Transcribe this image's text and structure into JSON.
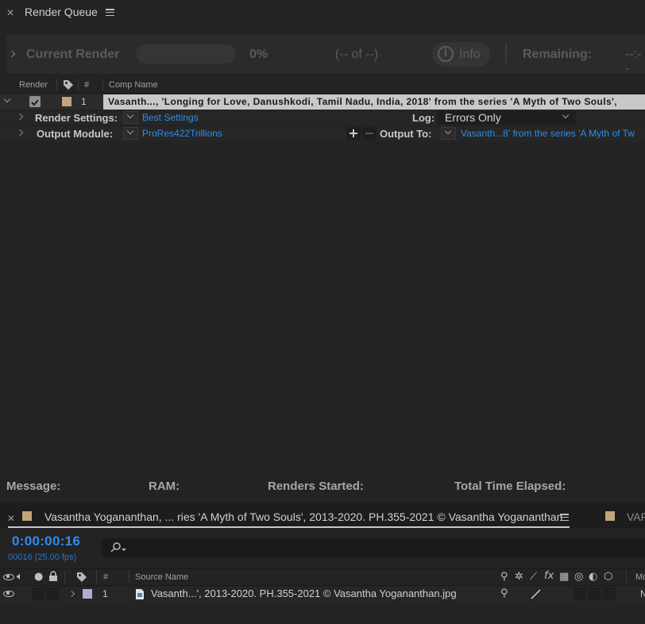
{
  "render_queue": {
    "panel_title": "Render Queue",
    "current_render_label": "Current Render",
    "progress_percent": "0%",
    "frame_counter": "(-- of --)",
    "info_label": "Info",
    "remaining_label": "Remaining:",
    "remaining_value": "--:--"
  },
  "columns": {
    "render": "Render",
    "number": "#",
    "comp_name": "Comp Name"
  },
  "queue_item": {
    "index": "1",
    "comp_name": "Vasanth..., 'Longing for Love, Danushkodi, Tamil Nadu, India, 2018' from the series 'A Myth of Two Souls',",
    "label_color": "#c4a57a",
    "render_settings_label": "Render Settings:",
    "render_settings_value": "Best Settings",
    "log_label": "Log:",
    "log_value": "Errors Only",
    "output_module_label": "Output Module:",
    "output_module_value": "ProRes422Trillions",
    "output_to_label": "Output To:",
    "output_to_value": "Vasanth...8' from the series 'A Myth of Tw"
  },
  "status_bar": {
    "message": "Message:",
    "ram": "RAM:",
    "renders_started": "Renders Started:",
    "total_time_elapsed": "Total Time Elapsed:"
  },
  "timeline": {
    "tab_title": "Vasantha Yogananthan,  ... ries 'A Myth of Two Souls', 2013-2020. PH.355-2021 © Vasantha Yogananthan",
    "tab_swatch_color": "#c4a57a",
    "second_tab_label": "VAP",
    "timecode": "0:00:00:16",
    "frame_info": "00016 (25.00 fps)",
    "search_placeholder": "",
    "col_number": "#",
    "col_source_name": "Source Name",
    "col_mode": "Mo",
    "layer": {
      "index": "1",
      "name": "Vasanth...', 2013-2020. PH.355-2021 © Vasantha Yogananthan.jpg",
      "label_color": "#b3a9d8",
      "mode_short": "N"
    }
  },
  "colors": {
    "accent_blue": "#2d8ceb",
    "panel_bg": "#232323"
  }
}
